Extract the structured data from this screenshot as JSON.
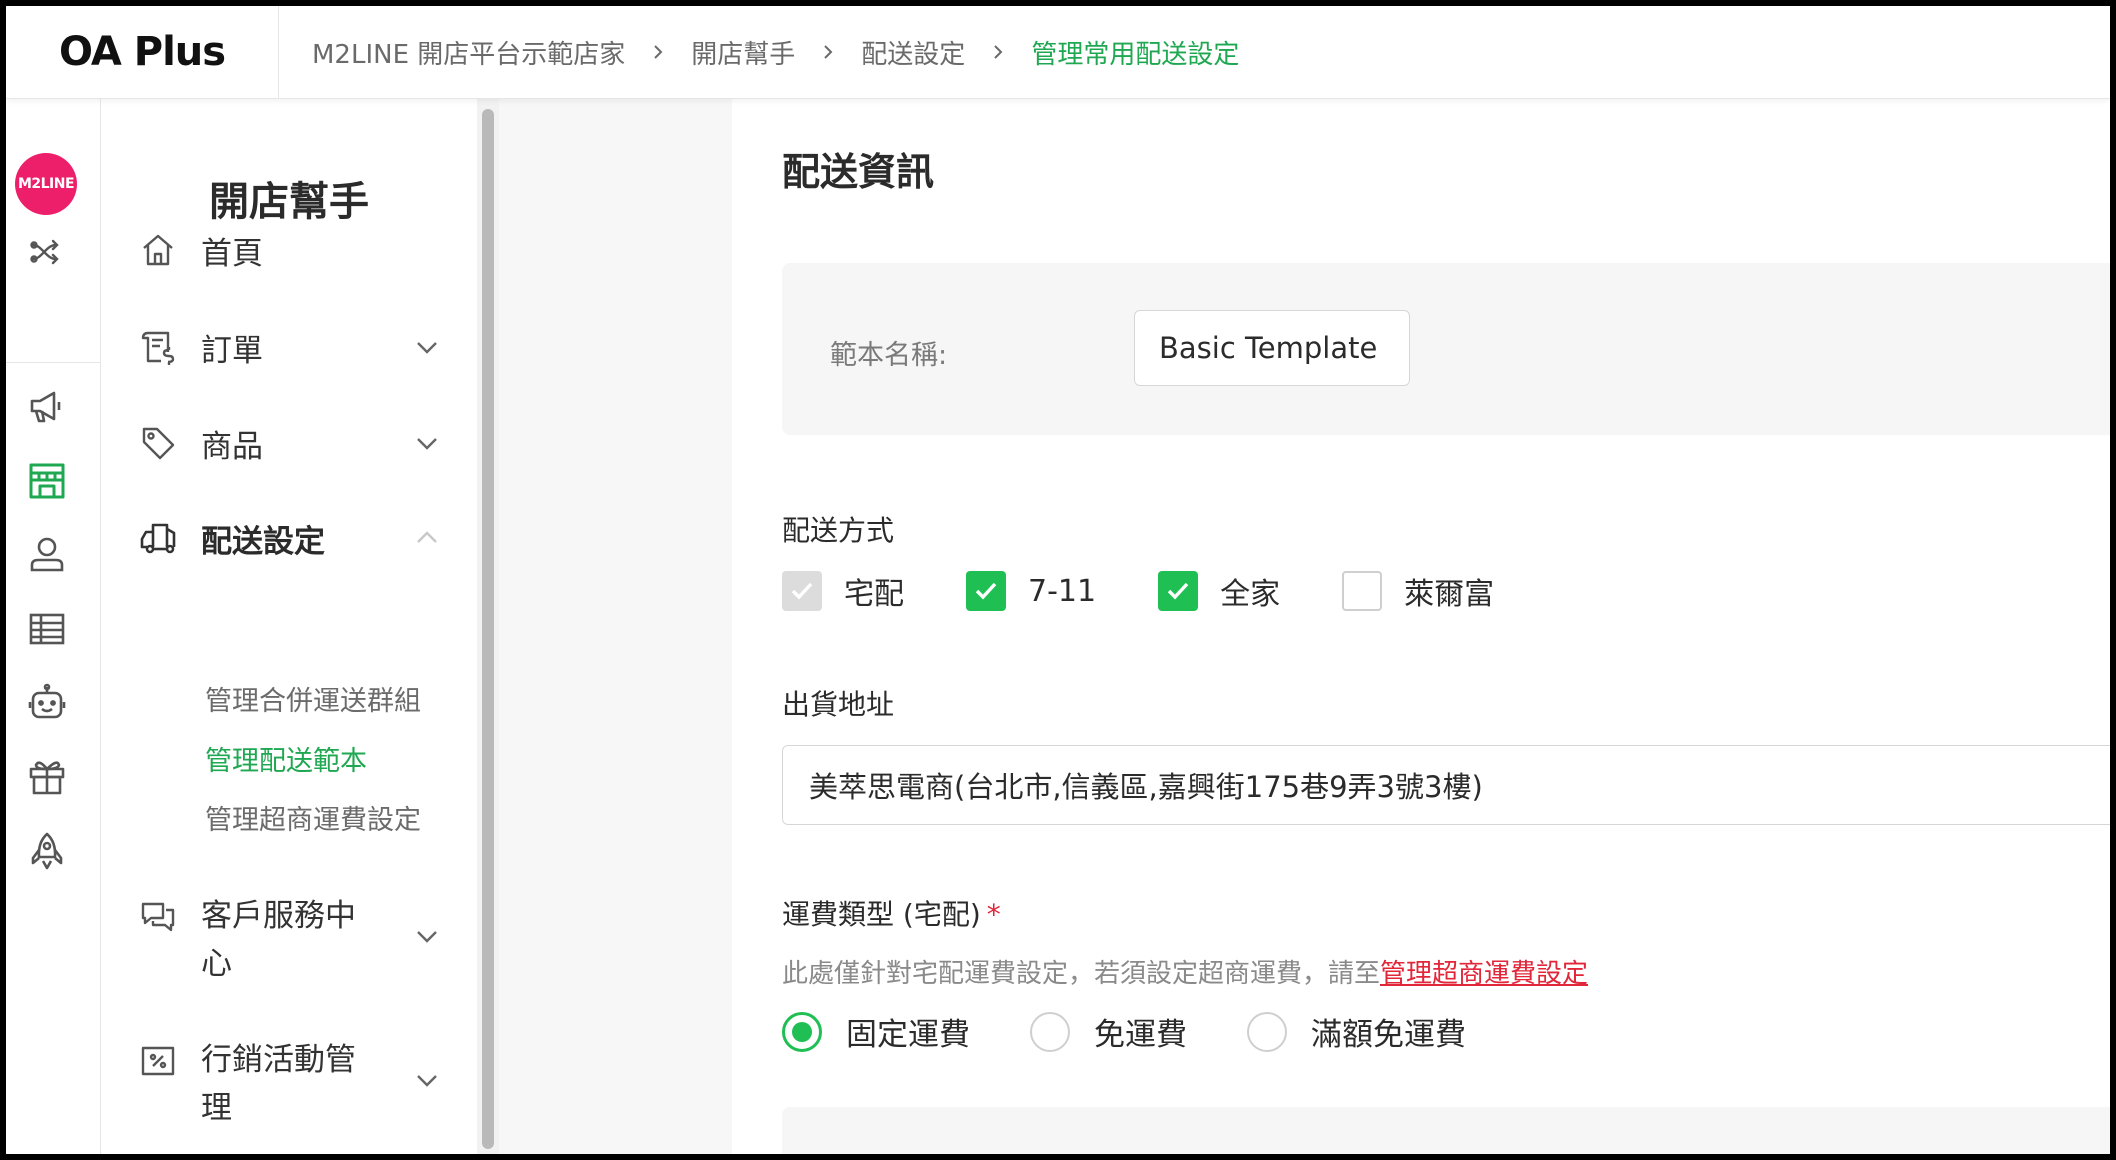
{
  "app": {
    "logo_text": "OA Plus"
  },
  "breadcrumb": [
    "M2LINE 開店平台示範店家",
    "開店幫手",
    "配送設定",
    "管理常用配送設定"
  ],
  "rail": {
    "brand_text": "M2LINE",
    "icons": [
      "shuffle-icon",
      "megaphone-icon",
      "store-icon",
      "user-icon",
      "table-icon",
      "robot-icon",
      "gift-icon",
      "rocket-icon"
    ],
    "active_icon": "store-icon",
    "accent": "#1fa851",
    "brand_color": "#ee1f6a"
  },
  "nav": {
    "title": "開店幫手",
    "items": [
      {
        "label": "首頁",
        "icon": "home-icon"
      },
      {
        "label": "訂單",
        "icon": "receipt-icon",
        "expandable": true
      },
      {
        "label": "商品",
        "icon": "tag-icon",
        "expandable": true
      },
      {
        "label": "配送設定",
        "icon": "truck-icon",
        "expanded": true
      },
      {
        "label": "客戶服務中心",
        "icon": "chat-icon",
        "expandable": true
      },
      {
        "label": "行銷活動管理",
        "icon": "coupon-icon",
        "expandable": true
      }
    ],
    "shipping_sub": [
      {
        "label": "管理合併運送群組",
        "active": false
      },
      {
        "label": "管理配送範本",
        "active": true
      },
      {
        "label": "管理超商運費設定",
        "active": false
      }
    ]
  },
  "content": {
    "section_title": "配送資訊",
    "template_label": "範本名稱:",
    "template_value": "Basic Template",
    "delivery_label": "配送方式",
    "delivery_options": [
      {
        "label": "宅配",
        "state": "checked-disabled"
      },
      {
        "label": "7-11",
        "state": "checked"
      },
      {
        "label": "全家",
        "state": "checked"
      },
      {
        "label": "萊爾富",
        "state": "unchecked"
      }
    ],
    "address_label": "出貨地址",
    "address_value": "美萃思電商(台北市,信義區,嘉興街175巷9弄3號3樓)",
    "fee_label": "運費類型 (宅配)",
    "required_mark": "*",
    "fee_hint": "此處僅針對宅配運費設定，若須設定超商運費，請至",
    "fee_hint_link": "管理超商運費設定",
    "fee_options": [
      {
        "label": "固定運費",
        "selected": true
      },
      {
        "label": "免運費",
        "selected": false
      },
      {
        "label": "滿額免運費",
        "selected": false
      }
    ]
  }
}
